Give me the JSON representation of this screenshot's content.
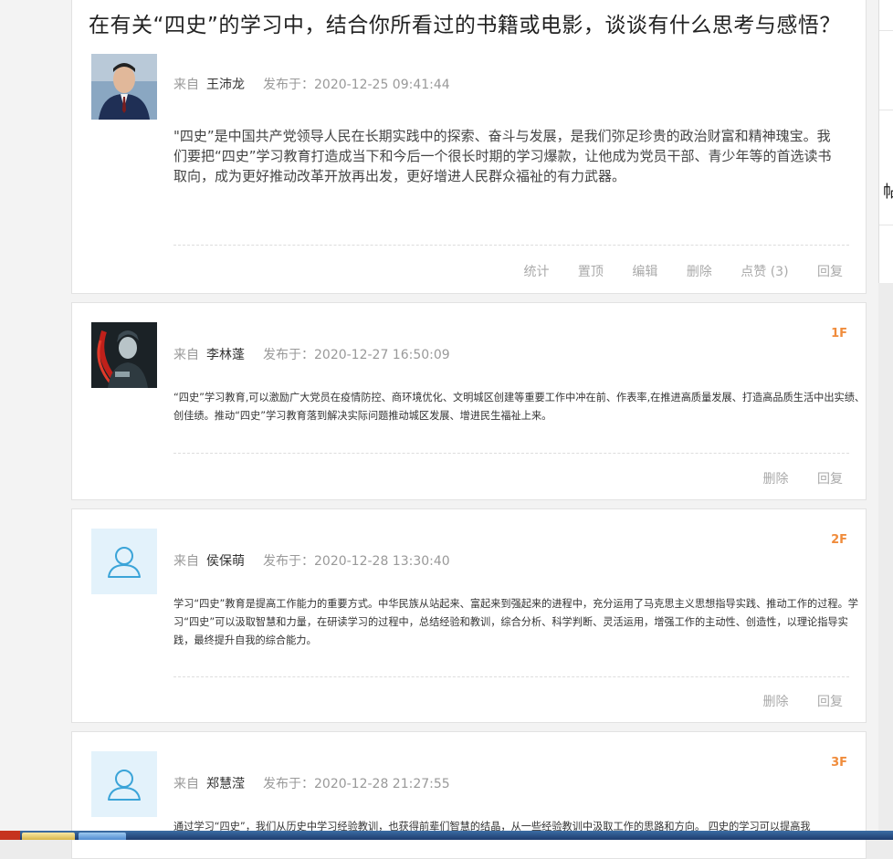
{
  "thread": {
    "title": "在有关“四史”的学习中，结合你所看过的书籍或电影，谈谈有什么思考与感悟？",
    "post": {
      "from_label": "来自",
      "author": "王沛龙",
      "date": "发布于：2020-12-25 09:41:44",
      "content": "\"四史”是中国共产党领导人民在长期实践中的探索、奋斗与发展，是我们弥足珍贵的政治财富和精神瑰宝。我们要把“四史”学习教育打造成当下和今后一个很长时期的学习爆款，让他成为党员干部、青少年等的首选读书取向，成为更好推动改革开放再出发，更好增进人民群众福祉的有力武器。",
      "actions": [
        "统计",
        "置顶",
        "编辑",
        "删除",
        "点赞 (3)",
        "回复"
      ]
    }
  },
  "replies": [
    {
      "floor": "1F",
      "from_label": "来自",
      "author": "李林蓬",
      "date": "发布于：2020-12-27 16:50:09",
      "content": "“四史”学习教育,可以激励广大党员在疫情防控、商环境优化、文明城区创建等重要工作中冲在前、作表率,在推进高质量发展、打造高品质生活中出实绩、创佳绩。推动“四史”学习教育落到解决实际问题推动城区发展、增进民生福祉上来。",
      "actions": [
        "删除",
        "回复"
      ]
    },
    {
      "floor": "2F",
      "from_label": "来自",
      "author": "侯保萌",
      "date": "发布于：2020-12-28 13:30:40",
      "content": "学习“四史”教育是提高工作能力的重要方式。中华民族从站起来、富起来到强起来的进程中，充分运用了马克思主义思想指导实践、推动工作的过程。学习“四史”可以汲取智慧和力量，在研读学习的过程中，总结经验和教训，综合分析、科学判断、灵活运用，增强工作的主动性、创造性，以理论指导实践，最终提升自我的综合能力。",
      "actions": [
        "删除",
        "回复"
      ]
    },
    {
      "floor": "3F",
      "from_label": "来自",
      "author": "郑慧滢",
      "date": "发布于：2020-12-28 21:27:55",
      "content": "通过学习“四史”，我们从历史中学习经验教训，也获得前辈们智慧的结晶，从一些经验教训中汲取工作的思路和方向。 四史的学习可以提高我",
      "actions": []
    }
  ],
  "sidebar_fragment": {
    "glyph": "帖"
  },
  "colors": {
    "floor": "#f08c3c",
    "avatar_placeholder_bg": "#e3f2fb",
    "avatar_placeholder_icon": "#3ba4d8"
  }
}
